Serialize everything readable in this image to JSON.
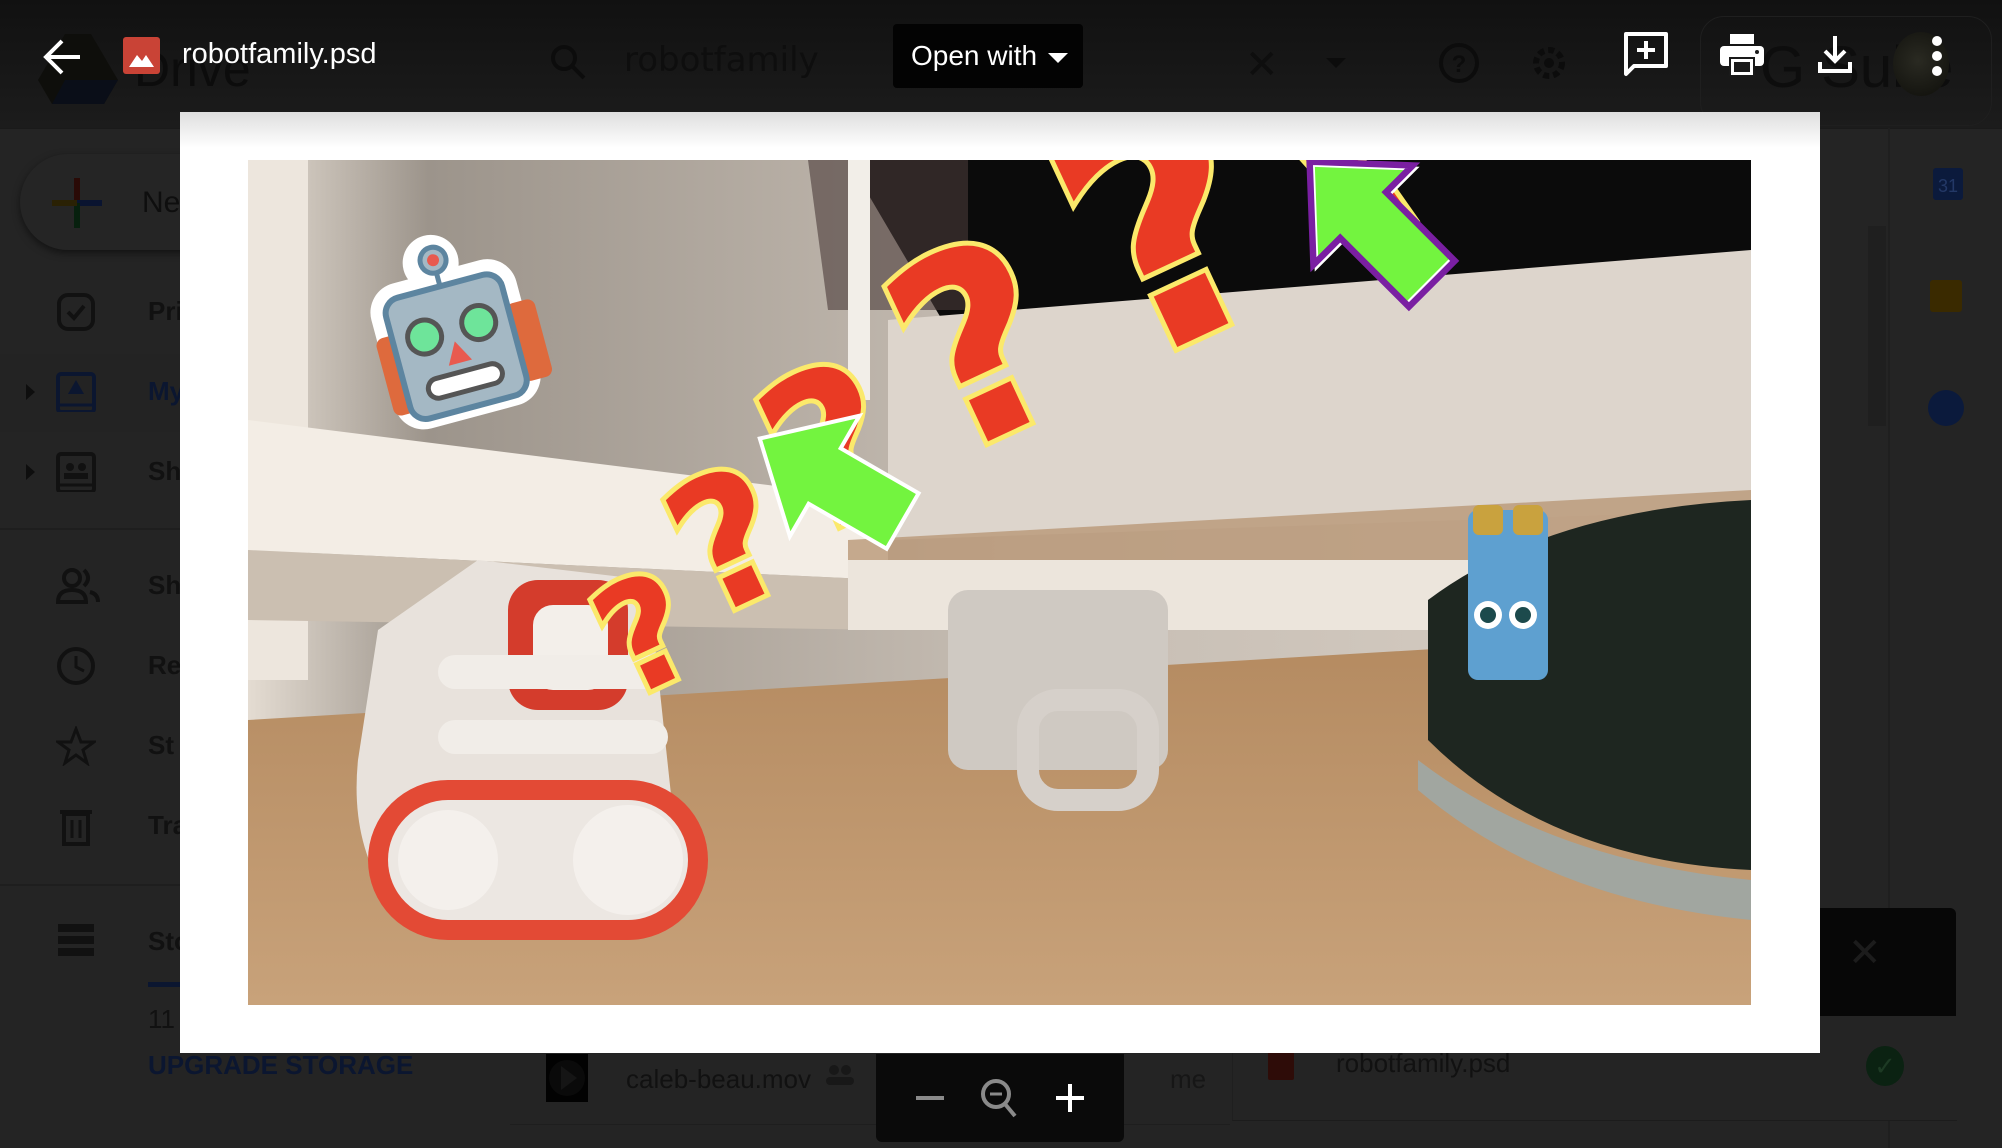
{
  "viewer": {
    "file_name": "robotfamily.psd",
    "open_with_label": "Open with",
    "actions": {
      "back": "back-arrow-icon",
      "add_comment": "add-comment-icon",
      "print": "print-icon",
      "download": "download-icon",
      "more": "more-vert-icon"
    },
    "zoom_controls": {
      "zoom_out": "minus-icon",
      "reset": "zoom-out-magnifier-icon",
      "zoom_in": "plus-icon"
    },
    "image_description": "Photo of a Cozmo robot on a wooden floor with red question marks, robot emoji sticker, mug, shoe and green arrows"
  },
  "background": {
    "app_name": "Drive",
    "search_query": "robotfamily",
    "gsuite_label": "G Suite",
    "new_button": "New",
    "nav": [
      {
        "label": "Priority",
        "icon": "priority-check-icon"
      },
      {
        "label": "My Drive",
        "icon": "my-drive-icon",
        "active": true
      },
      {
        "label": "Shared drives",
        "icon": "shared-drives-icon"
      },
      {
        "label": "Shared with me",
        "icon": "people-icon"
      },
      {
        "label": "Recent",
        "icon": "clock-icon"
      },
      {
        "label": "Starred",
        "icon": "star-icon"
      },
      {
        "label": "Trash",
        "icon": "trash-icon"
      }
    ],
    "nav_visible_labels": [
      "Pri",
      "My",
      "Sh",
      "Sh",
      "Re",
      "St",
      "Tra"
    ],
    "storage_label": "Sto",
    "storage_used": "11",
    "upgrade_label": "UPGRADE STORAGE",
    "file_row": {
      "name": "caleb-beau.mov",
      "owner": "me"
    },
    "upload_toast": {
      "file_name": "robotfamily.psd",
      "status": "complete"
    },
    "calendar_day": "31"
  }
}
